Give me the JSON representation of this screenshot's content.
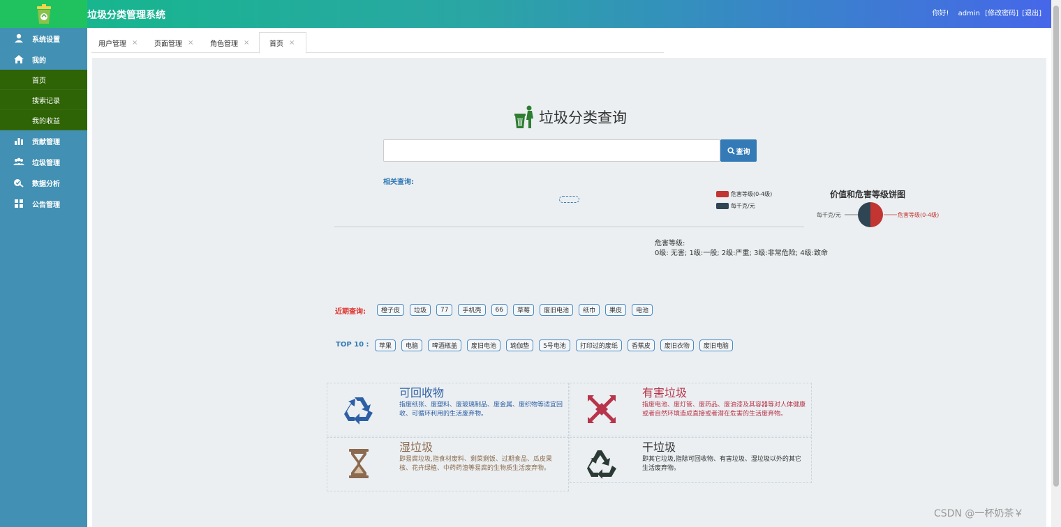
{
  "header": {
    "app_title": "垃圾分类管理系统",
    "greeting": "你好!",
    "user": "admin",
    "change_password": "[修改密码]",
    "logout": "[退出]"
  },
  "sidebar": {
    "items": [
      {
        "label": "系统设置",
        "icon": "user-icon"
      },
      {
        "label": "我的",
        "icon": "home-icon"
      }
    ],
    "sub_items": [
      "首页",
      "搜索记录",
      "我的收益"
    ],
    "items_after": [
      {
        "label": "贡献管理",
        "icon": "bar-chart-icon"
      },
      {
        "label": "垃圾管理",
        "icon": "group-icon"
      },
      {
        "label": "数据分析",
        "icon": "analysis-icon"
      },
      {
        "label": "公告管理",
        "icon": "grid-icon"
      }
    ]
  },
  "tabs": [
    {
      "label": "用户管理"
    },
    {
      "label": "页面管理"
    },
    {
      "label": "角色管理"
    },
    {
      "label": "首页",
      "active": true
    }
  ],
  "tab_close": "×",
  "search": {
    "title": "垃圾分类查询",
    "placeholder": "",
    "button": "查询",
    "related_label": "相关查询:"
  },
  "pie": {
    "title": "价值和危害等级饼图",
    "legend": [
      {
        "name": "危害等级(0-4级)",
        "color": "#c23531"
      },
      {
        "name": "每千克/元",
        "color": "#2f4554"
      }
    ],
    "label_left": "每千克/元",
    "label_right": "危害等级(0-4级)"
  },
  "danger": {
    "title": "危害等级:",
    "desc": "0级: 无害; 1级:一般; 2级:严重; 3级:非常危险; 4级:致命"
  },
  "recent": {
    "label": "近期查询:",
    "label_color": "#e0342f",
    "items": [
      "橙子皮",
      "垃圾",
      "77",
      "手机壳",
      "66",
      "草莓",
      "废旧电池",
      "纸巾",
      "果皮",
      "电池"
    ]
  },
  "top10": {
    "label": "TOP 10 :",
    "label_color": "#337ab7",
    "items": [
      "苹果",
      "电脑",
      "啤酒瓶盖",
      "废旧电池",
      "瑜伽垫",
      "5号电池",
      "打印过的废纸",
      "香蕉皮",
      "废旧衣物",
      "废旧电脑"
    ]
  },
  "categories": [
    {
      "title": "可回收物",
      "desc": "指废纸张、废塑料、废玻璃制品、废金属、废织物等适宜回收、可循环利用的生活废弃物。",
      "color": "#2d5fa6",
      "icon": "recycle-icon"
    },
    {
      "title": "有害垃圾",
      "desc": "指废电池、废灯管、废药品、废油漆及其容器等对人体健康或者自然环境造成直接或者潜在危害的生活废弃物。",
      "color": "#b8344a",
      "icon": "hazard-icon"
    },
    {
      "title": "湿垃圾",
      "desc": "即易腐垃圾,指食材废料、剩菜剩饭、过期食品、瓜皮果核、花卉绿植、中药药渣等易腐的生物质生活废弃物。",
      "color": "#8b6a4f",
      "icon": "hourglass-icon"
    },
    {
      "title": "干垃圾",
      "desc": "即其它垃圾,指除可回收物、有害垃圾、湿垃圾以外的其它生活废弃物。",
      "color": "#333333",
      "icon": "recycle-dark-icon"
    }
  ],
  "watermark": "CSDN @一杯奶茶￥"
}
